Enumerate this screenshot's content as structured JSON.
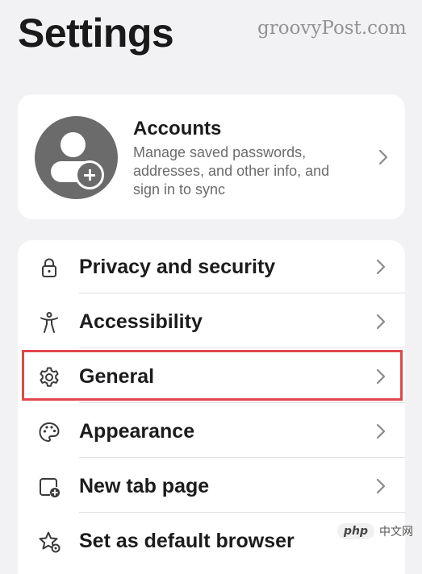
{
  "header": {
    "title": "Settings"
  },
  "watermark": {
    "text": "groovyPost.com"
  },
  "accounts": {
    "title": "Accounts",
    "subtitle": "Manage saved passwords, addresses, and other info, and sign in to sync"
  },
  "settings": {
    "items": [
      {
        "label": "Privacy and security",
        "icon": "lock-icon"
      },
      {
        "label": "Accessibility",
        "icon": "accessibility-icon"
      },
      {
        "label": "General",
        "icon": "gear-icon",
        "highlighted": true
      },
      {
        "label": "Appearance",
        "icon": "palette-icon"
      },
      {
        "label": "New tab page",
        "icon": "new-tab-icon"
      },
      {
        "label": "Set as default browser",
        "icon": "star-settings-icon"
      }
    ]
  },
  "badge": {
    "logo": "php",
    "text": "中文网"
  },
  "colors": {
    "highlight_border": "#e2474b",
    "background": "#f2f2f4",
    "card": "#ffffff"
  }
}
